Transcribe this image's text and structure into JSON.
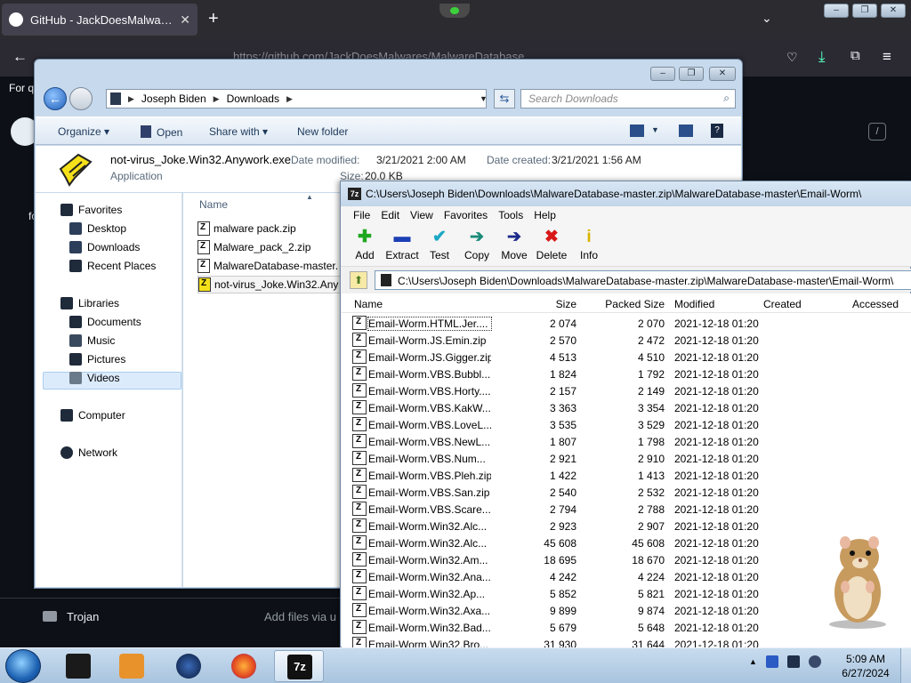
{
  "browser": {
    "tab_title": "GitHub - JackDoesMalwares/M...",
    "tab_close": "✕",
    "new_tab": "+",
    "tab_list": "⌄",
    "url": "https://github.com/JackDoesMalwares/MalwareDatabase",
    "bookmark_text": "For q",
    "left_text_1": "fo",
    "slash_key": "/",
    "bottom_folder": "Trojan",
    "bottom_hint": "Add files via u"
  },
  "explorer": {
    "breadcrumb": [
      "Joseph Biden",
      "Downloads"
    ],
    "search_placeholder": "Search Downloads",
    "commands": {
      "organize": "Organize",
      "open": "Open",
      "share_with": "Share with",
      "new_folder": "New folder"
    },
    "details": {
      "file_name": "not-virus_Joke.Win32.Anywork.exe",
      "file_type": "Application",
      "date_modified_label": "Date modified:",
      "date_modified": "3/21/2021 2:00 AM",
      "date_created_label": "Date created:",
      "date_created": "3/21/2021 1:56 AM",
      "size_label": "Size:",
      "size": "20.0 KB"
    },
    "nav": {
      "favorites": "Favorites",
      "desktop": "Desktop",
      "downloads": "Downloads",
      "recent_places": "Recent Places",
      "libraries": "Libraries",
      "documents": "Documents",
      "music": "Music",
      "pictures": "Pictures",
      "videos": "Videos",
      "computer": "Computer",
      "network": "Network"
    },
    "column_name": "Name",
    "files": [
      "malware pack.zip",
      "Malware_pack_2.zip",
      "MalwareDatabase-master.",
      "not-virus_Joke.Win32.Any"
    ]
  },
  "sevenzip": {
    "title": "C:\\Users\\Joseph Biden\\Downloads\\MalwareDatabase-master.zip\\MalwareDatabase-master\\Email-Worm\\",
    "menu": [
      "File",
      "Edit",
      "View",
      "Favorites",
      "Tools",
      "Help"
    ],
    "toolbar": {
      "add": "Add",
      "extract": "Extract",
      "test": "Test",
      "copy": "Copy",
      "move": "Move",
      "delete": "Delete",
      "info": "Info"
    },
    "path": "C:\\Users\\Joseph Biden\\Downloads\\MalwareDatabase-master.zip\\MalwareDatabase-master\\Email-Worm\\",
    "columns": {
      "name": "Name",
      "size": "Size",
      "packed": "Packed Size",
      "modified": "Modified",
      "created": "Created",
      "accessed": "Accessed"
    },
    "rows": [
      [
        "Email-Worm.HTML.Jer....",
        "2 074",
        "2 070",
        "2021-12-18 01:20"
      ],
      [
        "Email-Worm.JS.Emin.zip",
        "2 570",
        "2 472",
        "2021-12-18 01:20"
      ],
      [
        "Email-Worm.JS.Gigger.zip",
        "4 513",
        "4 510",
        "2021-12-18 01:20"
      ],
      [
        "Email-Worm.VBS.Bubbl...",
        "1 824",
        "1 792",
        "2021-12-18 01:20"
      ],
      [
        "Email-Worm.VBS.Horty....",
        "2 157",
        "2 149",
        "2021-12-18 01:20"
      ],
      [
        "Email-Worm.VBS.KakW...",
        "3 363",
        "3 354",
        "2021-12-18 01:20"
      ],
      [
        "Email-Worm.VBS.LoveL...",
        "3 535",
        "3 529",
        "2021-12-18 01:20"
      ],
      [
        "Email-Worm.VBS.NewL...",
        "1 807",
        "1 798",
        "2021-12-18 01:20"
      ],
      [
        "Email-Worm.VBS.Num...",
        "2 921",
        "2 910",
        "2021-12-18 01:20"
      ],
      [
        "Email-Worm.VBS.Pleh.zip",
        "1 422",
        "1 413",
        "2021-12-18 01:20"
      ],
      [
        "Email-Worm.VBS.San.zip",
        "2 540",
        "2 532",
        "2021-12-18 01:20"
      ],
      [
        "Email-Worm.VBS.Scare....",
        "2 794",
        "2 788",
        "2021-12-18 01:20"
      ],
      [
        "Email-Worm.Win32.Alc...",
        "2 923",
        "2 907",
        "2021-12-18 01:20"
      ],
      [
        "Email-Worm.Win32.Alc...",
        "45 608",
        "45 608",
        "2021-12-18 01:20"
      ],
      [
        "Email-Worm.Win32.Am...",
        "18 695",
        "18 670",
        "2021-12-18 01:20"
      ],
      [
        "Email-Worm.Win32.Ana...",
        "4 242",
        "4 224",
        "2021-12-18 01:20"
      ],
      [
        "Email-Worm.Win32.Ap...",
        "5 852",
        "5 821",
        "2021-12-18 01:20"
      ],
      [
        "Email-Worm.Win32.Axa...",
        "9 899",
        "9 874",
        "2021-12-18 01:20"
      ],
      [
        "Email-Worm.Win32.Bad...",
        "5 679",
        "5 648",
        "2021-12-18 01:20"
      ],
      [
        "Email-Worm.Win32.Bro...",
        "31 930",
        "31 644",
        "2021-12-18 01:20"
      ]
    ]
  },
  "taskbar": {
    "time": "5:09 AM",
    "date": "6/27/2024"
  },
  "icons": [
    "github-icon",
    "back-arrow-icon",
    "search-icon",
    "zip-file-icon",
    "exe-file-icon",
    "add-icon",
    "extract-icon",
    "test-icon",
    "copy-icon",
    "move-icon",
    "delete-icon",
    "info-icon",
    "folder-up-icon",
    "hamster-image",
    "start-orb-icon",
    "firefox-icon",
    "7zip-icon"
  ]
}
